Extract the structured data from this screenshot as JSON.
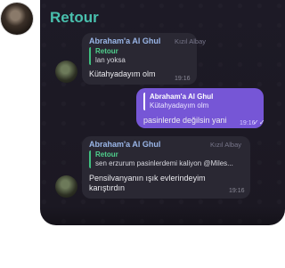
{
  "header": {
    "title": "Retour"
  },
  "messages": [
    {
      "sender": "Abraham'a Al Ghul",
      "role": "Kızıl Albay",
      "reply_name": "Retour",
      "reply_text": "lan yoksa",
      "text": "Kütahyadayım olm",
      "time": "19:16"
    },
    {
      "reply_name": "Abraham'a Al Ghul",
      "reply_text": "Kütahyadayım olm",
      "text": "pasinlerde değilsin yani",
      "time": "19:16",
      "status": "✓✓"
    },
    {
      "sender": "Abraham'a Al Ghul",
      "role": "Kızıl Albay",
      "reply_name": "Retour",
      "reply_text": "sen erzurum pasinlerdemi kaliyon @Miles...",
      "text_line1": "Pensilvanyanın ışık evlerindeyim",
      "text_line2": "karıştırdın",
      "time": "19:16"
    }
  ]
}
